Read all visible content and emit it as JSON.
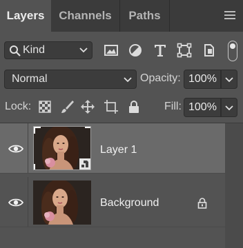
{
  "tabs": [
    {
      "label": "Layers"
    },
    {
      "label": "Channels"
    },
    {
      "label": "Paths"
    }
  ],
  "filter": {
    "kind_label": "Kind",
    "icons": [
      "image-filter-icon",
      "adjustment-filter-icon",
      "type-filter-icon",
      "shape-filter-icon",
      "smart-object-filter-icon"
    ]
  },
  "blend": {
    "mode": "Normal",
    "opacity_label": "Opacity:",
    "opacity_value": "100%"
  },
  "lock": {
    "label": "Lock:",
    "fill_label": "Fill:",
    "fill_value": "100%"
  },
  "layers": [
    {
      "name": "Layer 1",
      "selected": true,
      "smart_object": true,
      "locked": false
    },
    {
      "name": "Background",
      "selected": false,
      "smart_object": false,
      "locked": true
    }
  ],
  "colors": {
    "panel": "#535353",
    "tabbar": "#3b3b3b",
    "selected_row": "#6a6a6a",
    "field": "#3c3c3c"
  }
}
